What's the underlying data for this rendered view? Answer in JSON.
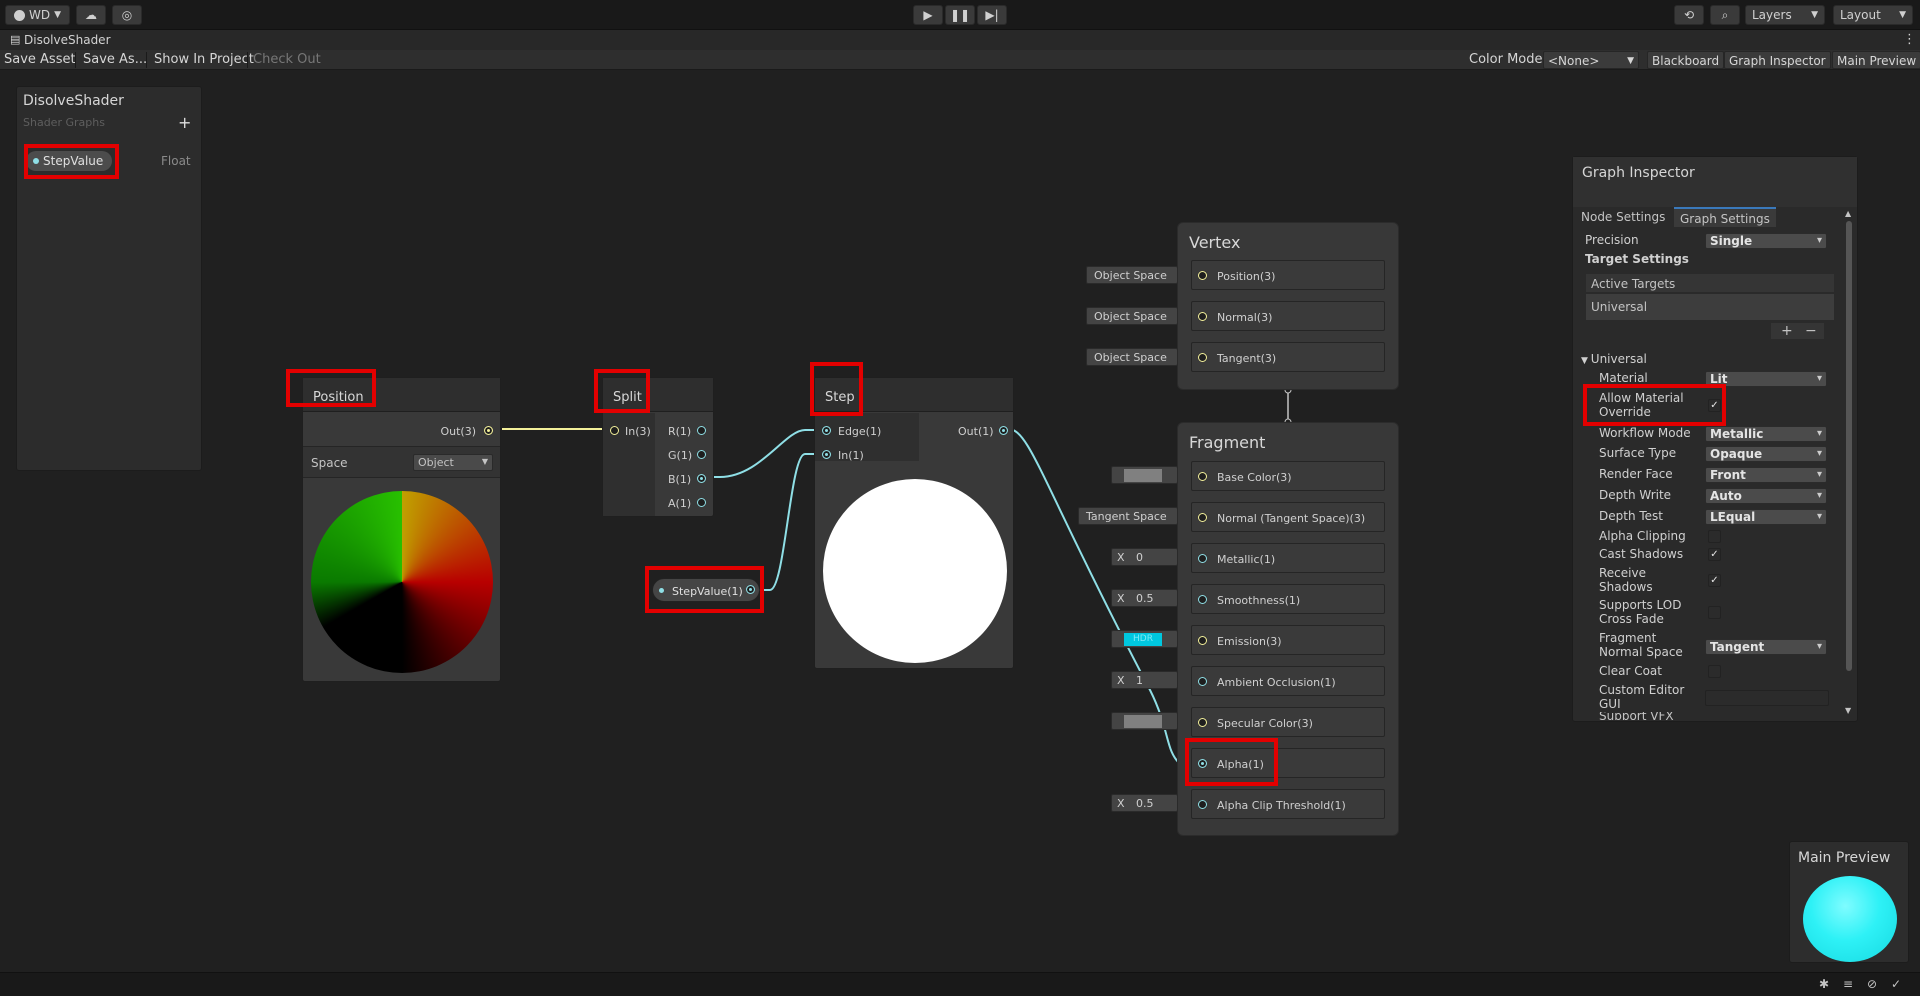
{
  "topbar": {
    "account_label": "WD",
    "layers_label": "Layers",
    "layout_label": "Layout"
  },
  "window": {
    "title": "DisolveShader"
  },
  "toolbar": {
    "save_asset": "Save Asset",
    "save_as": "Save As...",
    "show_in_project": "Show In Project",
    "check_out": "Check Out",
    "color_mode_label": "Color Mode",
    "color_mode_value": "<None>",
    "blackboard": "Blackboard",
    "graph_inspector": "Graph Inspector",
    "main_preview": "Main Preview"
  },
  "blackboard": {
    "title": "DisolveShader",
    "subtitle": "Shader Graphs",
    "property_name": "StepValue",
    "property_type": "Float"
  },
  "nodes": {
    "position": {
      "title": "Position",
      "out": "Out(3)",
      "space_label": "Space",
      "space_value": "Object"
    },
    "split": {
      "title": "Split",
      "in": "In(3)",
      "outputs": [
        "R(1)",
        "G(1)",
        "B(1)",
        "A(1)"
      ]
    },
    "step": {
      "title": "Step",
      "edge": "Edge(1)",
      "in": "In(1)",
      "out": "Out(1)"
    },
    "stepvalue": {
      "label": "StepValue(1)"
    }
  },
  "vertex": {
    "title": "Vertex",
    "slots": [
      {
        "label": "Position(3)",
        "input": "Object Space"
      },
      {
        "label": "Normal(3)",
        "input": "Object Space"
      },
      {
        "label": "Tangent(3)",
        "input": "Object Space"
      }
    ]
  },
  "fragment": {
    "title": "Fragment",
    "slots": [
      {
        "label": "Base Color(3)"
      },
      {
        "label": "Normal (Tangent Space)(3)",
        "input": "Tangent Space"
      },
      {
        "label": "Metallic(1)",
        "x": "X",
        "value": "0"
      },
      {
        "label": "Smoothness(1)",
        "x": "X",
        "value": "0.5"
      },
      {
        "label": "Emission(3)",
        "hdr": "HDR"
      },
      {
        "label": "Ambient Occlusion(1)",
        "x": "X",
        "value": "1"
      },
      {
        "label": "Specular Color(3)"
      },
      {
        "label": "Alpha(1)"
      },
      {
        "label": "Alpha Clip Threshold(1)",
        "x": "X",
        "value": "0.5"
      }
    ]
  },
  "inspector": {
    "title": "Graph Inspector",
    "tabs": [
      "Node Settings",
      "Graph Settings"
    ],
    "precision_label": "Precision",
    "precision_value": "Single",
    "target_settings": "Target Settings",
    "active_targets": "Active Targets",
    "target_item": "Universal",
    "section": "Universal",
    "material_label": "Material",
    "material_value": "Lit",
    "allow_override": "Allow Material Override",
    "workflow_label": "Workflow Mode",
    "workflow_value": "Metallic",
    "surface_label": "Surface Type",
    "surface_value": "Opaque",
    "render_face_label": "Render Face",
    "render_face_value": "Front",
    "depth_write_label": "Depth Write",
    "depth_write_value": "Auto",
    "depth_test_label": "Depth Test",
    "depth_test_value": "LEqual",
    "alpha_clipping": "Alpha Clipping",
    "cast_shadows": "Cast Shadows",
    "receive_shadows": "Receive Shadows",
    "supports_lod": "Supports LOD Cross Fade",
    "fragment_normal_label": "Fragment Normal Space",
    "fragment_normal_value": "Tangent",
    "clear_coat": "Clear Coat",
    "custom_editor": "Custom Editor GUI",
    "support_vfx": "Support VFX"
  },
  "preview": {
    "title": "Main Preview"
  }
}
